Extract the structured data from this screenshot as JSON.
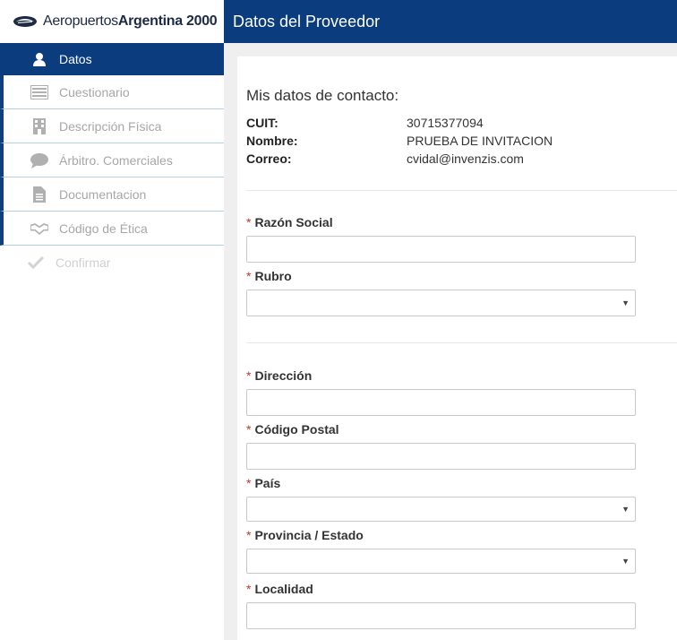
{
  "brand": {
    "name_light": "Aeropuertos",
    "name_bold": "Argentina 2000"
  },
  "header": {
    "title": "Datos del Proveedor"
  },
  "sidebar": {
    "items": [
      {
        "label": "Datos",
        "icon": "user-icon"
      },
      {
        "label": "Cuestionario",
        "icon": "list-icon"
      },
      {
        "label": "Descripción Física",
        "icon": "building-icon"
      },
      {
        "label": "Árbitro. Comerciales",
        "icon": "speech-bubble-icon"
      },
      {
        "label": "Documentacion",
        "icon": "document-icon"
      },
      {
        "label": "Código de Ética",
        "icon": "handshake-icon"
      },
      {
        "label": "Confirmar",
        "icon": "checkmark-icon"
      }
    ]
  },
  "contact": {
    "title": "Mis datos de contacto:",
    "rows": [
      {
        "key": "CUIT:",
        "value": "30715377094"
      },
      {
        "key": "Nombre:",
        "value": "PRUEBA DE INVITACION"
      },
      {
        "key": "Correo:",
        "value": "cvidal@invenzis.com"
      }
    ]
  },
  "form": {
    "required_mark": "*",
    "fields": [
      {
        "label": "Razón Social",
        "type": "text",
        "value": ""
      },
      {
        "label": "Rubro",
        "type": "select",
        "value": ""
      },
      {
        "label": "Dirección",
        "type": "text",
        "value": ""
      },
      {
        "label": "Código Postal",
        "type": "text",
        "value": ""
      },
      {
        "label": "País",
        "type": "select",
        "value": ""
      },
      {
        "label": "Provincia / Estado",
        "type": "select",
        "value": ""
      },
      {
        "label": "Localidad",
        "type": "text",
        "value": ""
      }
    ]
  },
  "colors": {
    "primary": "#0b3d7e",
    "required": "#c0392b",
    "background": "#efefef"
  }
}
